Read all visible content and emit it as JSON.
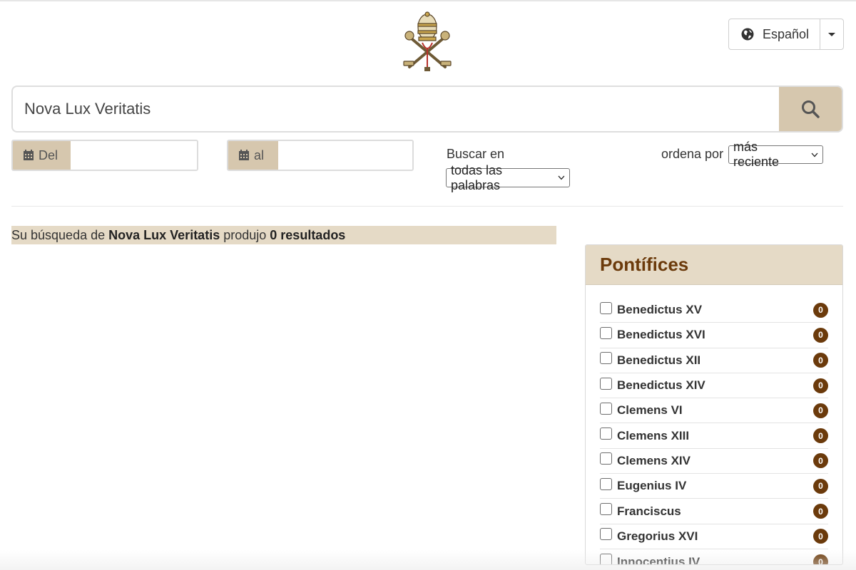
{
  "language": {
    "label": "Español",
    "icon": "globe-icon"
  },
  "search": {
    "value": "Nova Lux Veritatis",
    "icon": "search-icon"
  },
  "date_from": {
    "label": "Del",
    "value": "",
    "icon": "calendar-icon"
  },
  "date_to": {
    "label": "al",
    "value": "",
    "icon": "calendar-icon"
  },
  "search_in": {
    "label": "Buscar en",
    "selected": "todas las palabras"
  },
  "sort": {
    "label": "ordena por",
    "selected": "más reciente"
  },
  "results": {
    "prefix": "Su búsqueda de",
    "query": "Nova Lux Veritatis",
    "middle": "produjo",
    "count": "0 resultados"
  },
  "pontifices": {
    "title": "Pontífices",
    "items": [
      {
        "name": "Benedictus XV",
        "count": "0"
      },
      {
        "name": "Benedictus XVI",
        "count": "0"
      },
      {
        "name": "Benedictus XII",
        "count": "0"
      },
      {
        "name": "Benedictus XIV",
        "count": "0"
      },
      {
        "name": "Clemens VI",
        "count": "0"
      },
      {
        "name": "Clemens XIII",
        "count": "0"
      },
      {
        "name": "Clemens XIV",
        "count": "0"
      },
      {
        "name": "Eugenius IV",
        "count": "0"
      },
      {
        "name": "Franciscus",
        "count": "0"
      },
      {
        "name": "Gregorius XVI",
        "count": "0"
      },
      {
        "name": "Innocentius IV",
        "count": "0"
      }
    ]
  },
  "colors": {
    "accent": "#d6c7ae",
    "highlight": "#e5dac6",
    "brown": "#6b3a0b"
  }
}
